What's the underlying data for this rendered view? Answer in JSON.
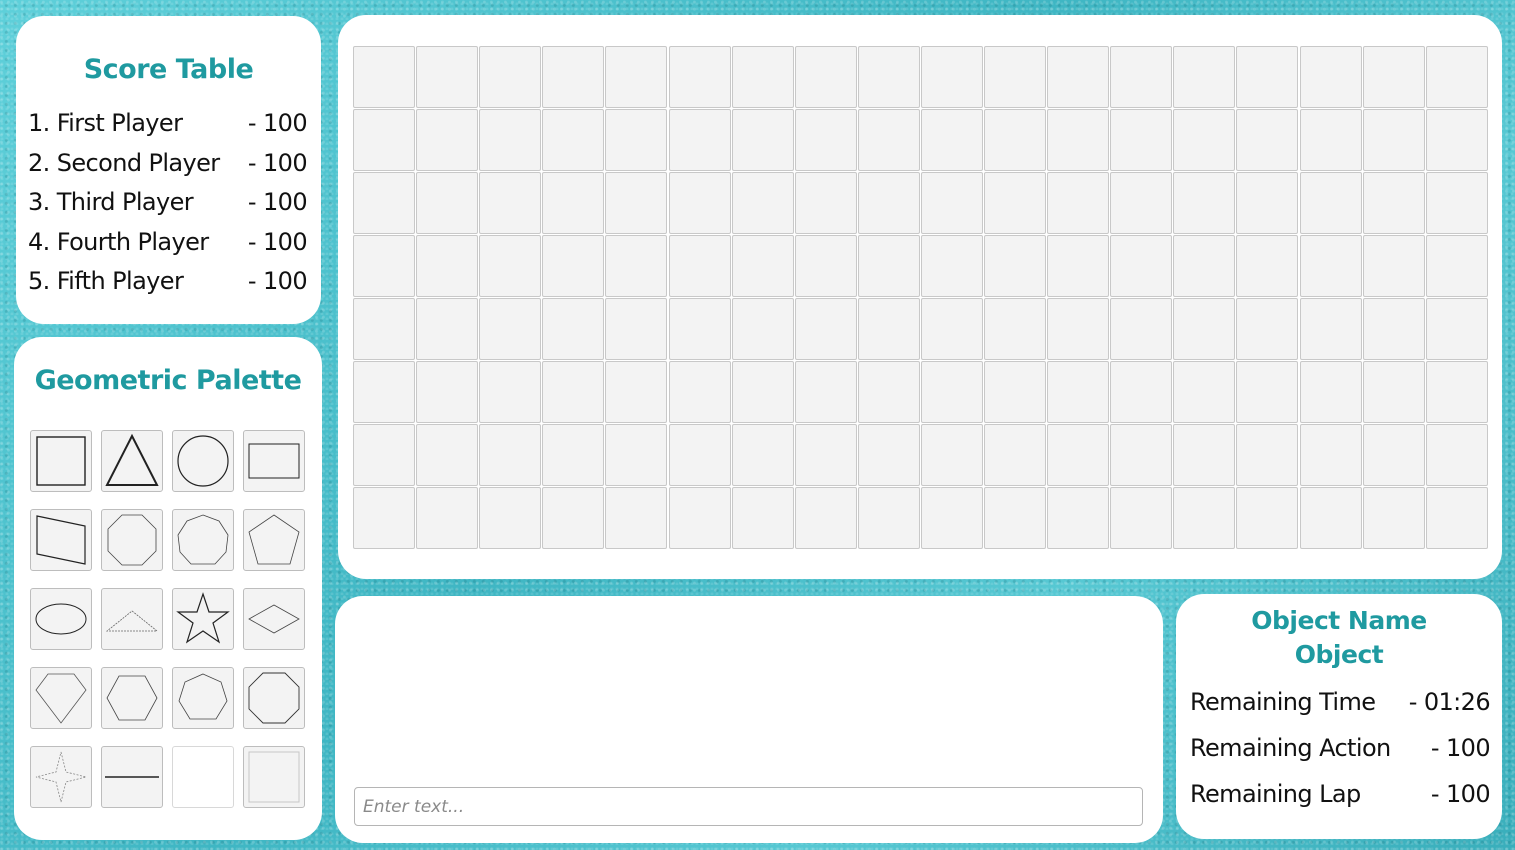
{
  "score_table": {
    "title": "Score Table",
    "rows": [
      {
        "label": "1. First Player",
        "score": "- 100"
      },
      {
        "label": "2. Second Player",
        "score": "- 100"
      },
      {
        "label": "3. Third Player",
        "score": "- 100"
      },
      {
        "label": "4. Fourth Player",
        "score": "- 100"
      },
      {
        "label": "5. Fifth Player",
        "score": "- 100"
      }
    ]
  },
  "palette": {
    "title": "Geometric Palette",
    "shapes": [
      "square-icon",
      "triangle-icon",
      "circle-icon",
      "rectangle-icon",
      "trapezoid-icon",
      "octagon-icon",
      "nonagon-icon",
      "pentagon-icon",
      "ellipse-icon",
      "dashed-triangle-icon",
      "star-icon",
      "rhombus-icon",
      "kite-icon",
      "hexagon-icon",
      "heptagon-icon",
      "octagon-large-icon",
      "four-point-star-icon",
      "line-icon",
      "blank-icon",
      "blank-square-icon"
    ]
  },
  "board": {
    "rows": 8,
    "cols": 18
  },
  "chat": {
    "placeholder": "Enter text..."
  },
  "info": {
    "object_name_label": "Object Name",
    "object_value": "Object",
    "rows": [
      {
        "label": "Remaining Time",
        "value": "- 01:26"
      },
      {
        "label": "Remaining Action",
        "value": "- 100"
      },
      {
        "label": "Remaining Lap",
        "value": "- 100"
      }
    ]
  },
  "colors": {
    "accent": "#1f9aa0",
    "background": "#4cc3cf",
    "tile": "#f3f3f3"
  }
}
